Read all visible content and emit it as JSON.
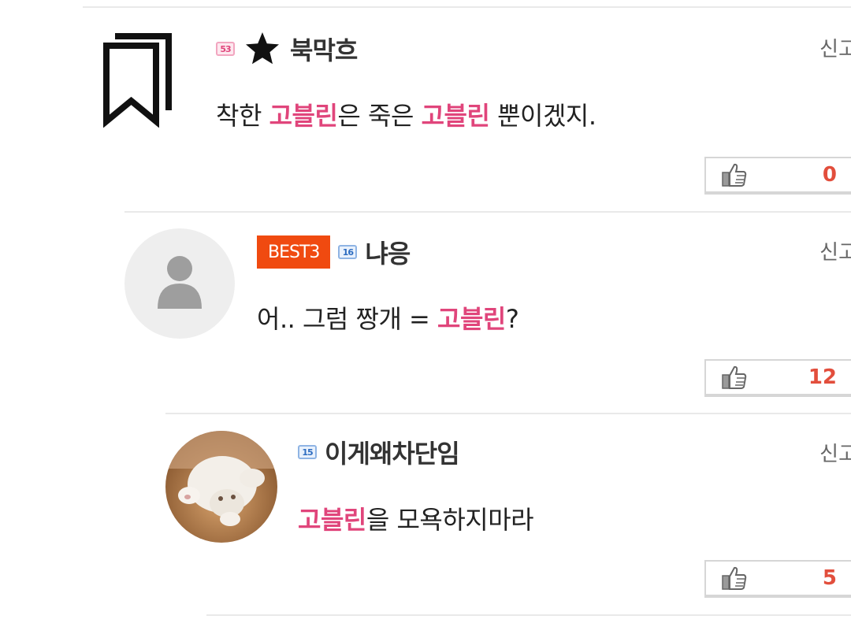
{
  "common": {
    "report_label": "신고"
  },
  "comments": [
    {
      "level": "53",
      "username": "북막흐",
      "text_parts": [
        "착한 ",
        "고블린",
        "은 죽은 ",
        "고블린",
        " 뿐이겠지."
      ],
      "likes": "0"
    },
    {
      "best_label": "BEST3",
      "level": "16",
      "username": "냐응",
      "text_parts": [
        "어.. 그럼 짱개 = ",
        "고블린",
        "?"
      ],
      "likes": "12"
    },
    {
      "level": "15",
      "username": "이게왜차단임",
      "text_parts": [
        "고블린",
        "을 모욕하지마라"
      ],
      "likes": "5"
    }
  ],
  "colors": {
    "highlight": "#e0457b",
    "best_badge": "#f04a10",
    "like_count": "#e24e3c"
  }
}
